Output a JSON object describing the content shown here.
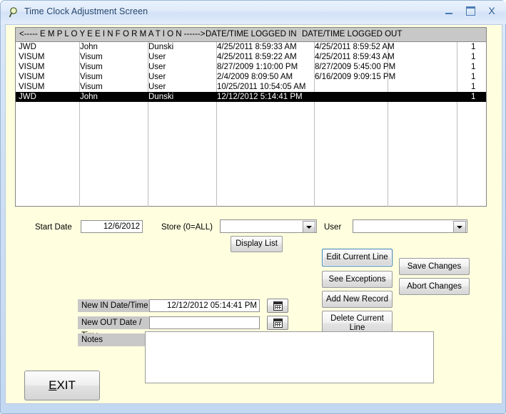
{
  "window": {
    "title": "Time Clock Adjustment Screen",
    "icon": "magnifier-icon",
    "minimize_label": "–",
    "maximize_label": "□",
    "close_label": "X",
    "background_color": "#ffffe0",
    "titlebar_color": "#dfeafa"
  },
  "grid": {
    "header": {
      "employee_information": "<----- E M P L O Y E E    I N F O R M A T I O N ------>",
      "logged_in": "DATE/TIME LOGGED IN",
      "logged_out": "DATE/TIME LOGGED OUT"
    },
    "rows": [
      {
        "code": "JWD",
        "first": "John",
        "last": "Dunski",
        "in": "4/25/2011 8:59:33 AM",
        "out": "4/25/2011 8:59:52 AM",
        "blank": "",
        "num": "1",
        "selected": false
      },
      {
        "code": "VISUM",
        "first": "Visum",
        "last": "User",
        "in": "4/25/2011 8:59:22 AM",
        "out": "4/25/2011 8:59:43 AM",
        "blank": "",
        "num": "1",
        "selected": false
      },
      {
        "code": "VISUM",
        "first": "Visum",
        "last": "User",
        "in": "8/27/2009 1:10:00 PM",
        "out": "8/27/2009 5:45:00 PM",
        "blank": "",
        "num": "1",
        "selected": false
      },
      {
        "code": "VISUM",
        "first": "Visum",
        "last": "User",
        "in": "2/4/2009 8:09:50 AM",
        "out": "6/16/2009 9:09:15 PM",
        "blank": "",
        "num": "1",
        "selected": false
      },
      {
        "code": "VISUM",
        "first": "Visum",
        "last": "User",
        "in": "10/25/2011 10:54:05 AM",
        "out": "",
        "blank": "",
        "num": "1",
        "selected": false
      },
      {
        "code": "JWD",
        "first": "John",
        "last": "Dunski",
        "in": "12/12/2012 5:14:41 PM",
        "out": "",
        "blank": "",
        "num": "1",
        "selected": true
      }
    ]
  },
  "filters": {
    "start_date_label": "Start Date",
    "start_date_value": "12/6/2012",
    "store_label": "Store (0=ALL)",
    "store_value": "",
    "user_label": "User",
    "user_value": "",
    "display_list_label": "Display List"
  },
  "actions": {
    "edit_current_line": "Edit Current Line",
    "see_exceptions": "See Exceptions",
    "add_new_record": "Add New Record",
    "delete_current_line": "Delete Current\nLine",
    "save_changes": "Save Changes",
    "abort_changes": "Abort Changes"
  },
  "edit_form": {
    "new_in_label": "New IN Date/Time",
    "new_in_value": "12/12/2012 05:14:41 PM",
    "new_out_label": "New OUT Date / Time",
    "new_out_value": "",
    "notes_label": "Notes",
    "notes_value": "",
    "calendar_icon": "calendar-icon"
  },
  "exit": {
    "label_prefix": "",
    "label_accel": "E",
    "label_rest": "XIT"
  }
}
